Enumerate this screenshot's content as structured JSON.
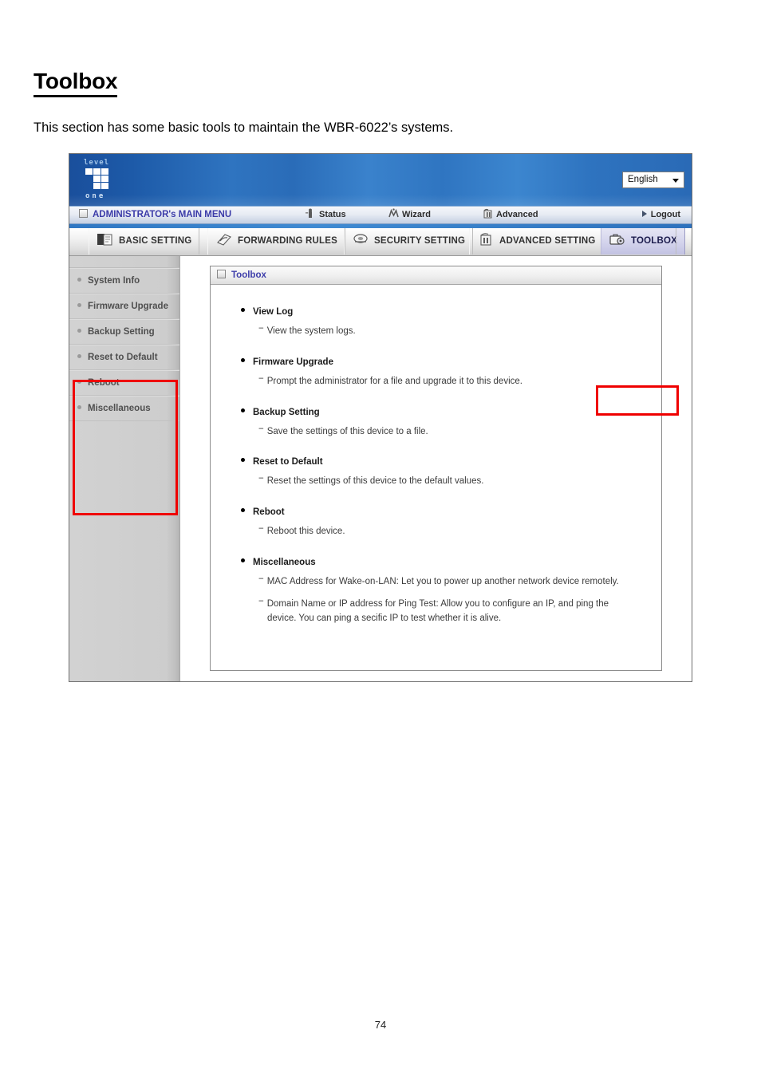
{
  "document": {
    "title": "Toolbox",
    "intro": "This section has some basic tools to maintain the WBR-6022’s systems.",
    "page_number": "74"
  },
  "screenshot": {
    "banner": {
      "logo_top": "level",
      "logo_bottom": "one",
      "language_value": "English",
      "language_icon": "chevron-down-icon"
    },
    "topnav": {
      "main_menu": "ADMINISTRATOR's MAIN MENU",
      "main_menu_icon": "window-icon",
      "items": [
        {
          "label": "Status",
          "icon": "person-status-icon"
        },
        {
          "label": "Wizard",
          "icon": "wizard-wand-icon"
        },
        {
          "label": "Advanced",
          "icon": "advanced-book-icon"
        }
      ],
      "logout": "Logout",
      "logout_icon": "triangle-right-icon"
    },
    "tabs": [
      {
        "label": "BASIC SETTING",
        "icon": "basic-setting-icon",
        "active": false
      },
      {
        "label": "FORWARDING RULES",
        "icon": "forwarding-rules-icon",
        "active": false
      },
      {
        "label": "SECURITY SETTING",
        "icon": "security-setting-icon",
        "active": false
      },
      {
        "label": "ADVANCED SETTING",
        "icon": "advanced-setting-icon",
        "active": false
      },
      {
        "label": "TOOLBOX",
        "icon": "toolbox-icon",
        "active": true
      }
    ],
    "sidebar": {
      "items": [
        {
          "label": "System Info"
        },
        {
          "label": "Firmware Upgrade"
        },
        {
          "label": "Backup Setting"
        },
        {
          "label": "Reset to Default"
        },
        {
          "label": "Reboot"
        },
        {
          "label": "Miscellaneous"
        }
      ]
    },
    "panel": {
      "header": "Toolbox",
      "header_icon": "window-icon",
      "entries": [
        {
          "title": "View Log",
          "desc": "View the system logs."
        },
        {
          "title": "Firmware Upgrade",
          "desc": "Prompt the administrator for a file and upgrade it to this device."
        },
        {
          "title": "Backup Setting",
          "desc": "Save the settings of this device to a file."
        },
        {
          "title": "Reset to Default",
          "desc": "Reset the settings of this device to the default values."
        },
        {
          "title": "Reboot",
          "desc": "Reboot this device."
        },
        {
          "title": "Miscellaneous",
          "desc": "MAC Address for Wake-on-LAN: Let you to power up another network device remotely.",
          "desc2": "Domain Name or IP address for Ping Test: Allow you to configure an IP, and ping the",
          "desc2_cont": "device. You can ping a secific IP to test whether it is alive."
        }
      ]
    },
    "annotations": {
      "accent_color": "#ef0000",
      "tab_highlight": "TOOLBOX",
      "sidebar_highlight": "sidebar-menu-items"
    }
  }
}
